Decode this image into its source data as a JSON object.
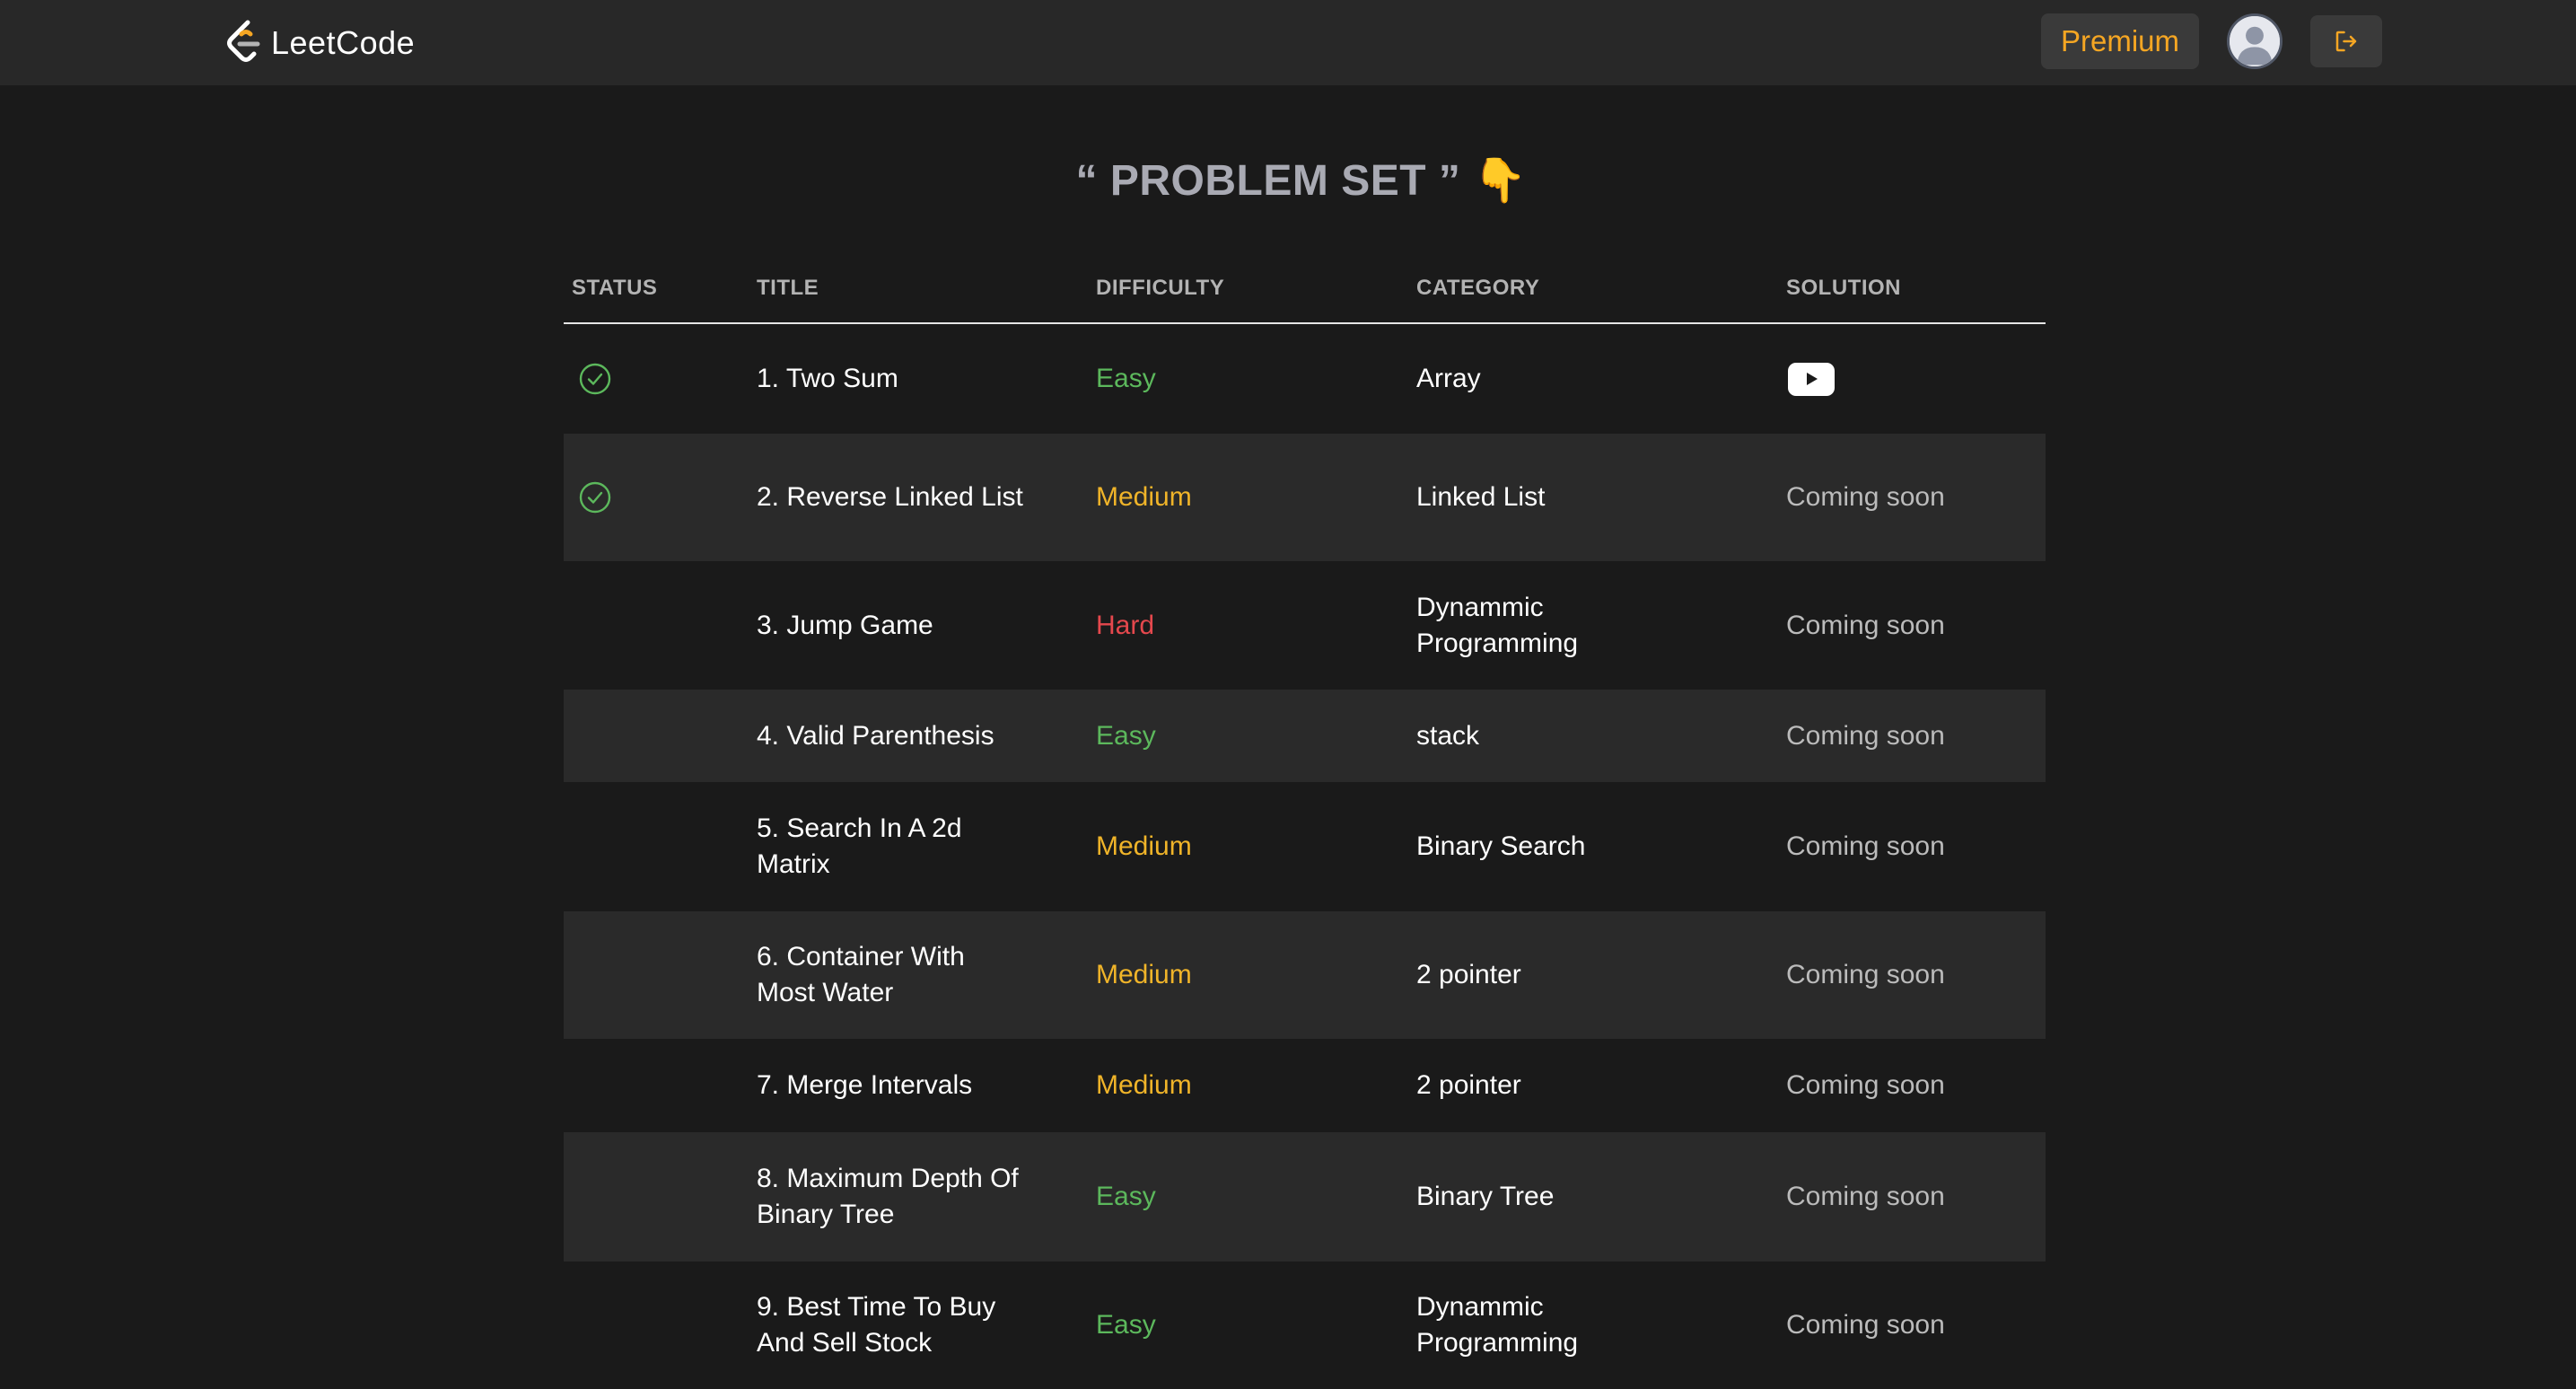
{
  "navbar": {
    "brand": "LeetCode",
    "premium_label": "Premium",
    "logo_icon": "leetcode-logo-icon",
    "avatar_icon": "user-avatar-icon",
    "logout_icon": "logout-icon"
  },
  "page": {
    "title": "“ PROBLEM SET ” 👇"
  },
  "table": {
    "headers": {
      "status": "STATUS",
      "title": "TITLE",
      "difficulty": "DIFFICULTY",
      "category": "CATEGORY",
      "solution": "SOLUTION"
    },
    "rows": [
      {
        "solved": true,
        "title": "1. Two Sum",
        "difficulty": "Easy",
        "category": "Array",
        "solution": "",
        "solution_icon": "youtube-icon"
      },
      {
        "solved": true,
        "title": "2. Reverse Linked List",
        "difficulty": "Medium",
        "category": "Linked List",
        "solution": "Coming soon"
      },
      {
        "solved": false,
        "title": "3. Jump Game",
        "difficulty": "Hard",
        "category": "Dynammic Programming",
        "solution": "Coming soon"
      },
      {
        "solved": false,
        "title": "4. Valid Parenthesis",
        "difficulty": "Easy",
        "category": "stack",
        "solution": "Coming soon"
      },
      {
        "solved": false,
        "title": "5. Search In A 2d Matrix",
        "difficulty": "Medium",
        "category": "Binary Search",
        "solution": "Coming soon"
      },
      {
        "solved": false,
        "title": "6. Container With Most Water",
        "difficulty": "Medium",
        "category": "2 pointer",
        "solution": "Coming soon"
      },
      {
        "solved": false,
        "title": "7. Merge Intervals",
        "difficulty": "Medium",
        "category": "2 pointer",
        "solution": "Coming soon"
      },
      {
        "solved": false,
        "title": "8. Maximum Depth Of Binary Tree",
        "difficulty": "Easy",
        "category": "Binary Tree",
        "solution": "Coming soon"
      },
      {
        "solved": false,
        "title": "9. Best Time To Buy And Sell Stock",
        "difficulty": "Easy",
        "category": "Dynammic Programming",
        "solution": "Coming soon"
      }
    ]
  },
  "colors": {
    "background": "#1a1a1a",
    "navbar": "#282828",
    "accent": "#f5a623",
    "easy": "#5cb85c",
    "medium": "#f0b429",
    "hard": "#e5484d",
    "solved_check": "#5cb85c"
  }
}
